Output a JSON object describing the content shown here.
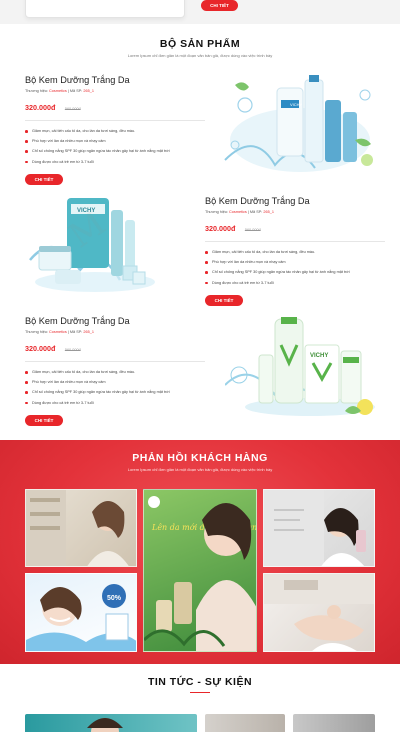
{
  "top": {
    "button_label": "CHI TIẾT"
  },
  "products_section": {
    "title": "BỘ SẢN PHẨM",
    "subtitle": "Lorem Ipsum chỉ đơn giản là một đoạn văn bản giả, được dùng vào việc trình bày"
  },
  "products": [
    {
      "name": "Bộ Kem Dưỡng Trắng Da",
      "brand_label": "Thương hiệu:",
      "brand": "Cosmetics",
      "sku_label": "Mã SP:",
      "sku": "265_1",
      "price": "320.000đ",
      "old_price": "560.000đ",
      "features": [
        "Giảm mụn, cải tiến cấu tố da, cho làn da tươi sáng, đều màu.",
        "Phù hợp với làn da nhiều mụn và nhạy cảm",
        "Chỉ số chống nắng SPF 30 giúp ngăn ngừa tác nhân gây hại từ ánh nắng mặt trời",
        "Dùng được cho cả trẻ em từ 3-7 tuổi"
      ],
      "button_label": "CHI TIẾT"
    },
    {
      "name": "Bộ Kem Dưỡng Trắng Da",
      "brand_label": "Thương hiệu:",
      "brand": "Cosmetics",
      "sku_label": "Mã SP:",
      "sku": "265_1",
      "price": "320.000đ",
      "old_price": "560.000đ",
      "features": [
        "Giảm mụn, cải tiến cấu tố da, cho làn da tươi sáng, đều màu.",
        "Phù hợp với làn da nhiều mụn và nhạy cảm",
        "Chỉ số chống nắng SPF 30 giúp ngăn ngừa tác nhân gây hại từ ánh nắng mặt trời",
        "Dùng được cho cả trẻ em từ 3-7 tuổi"
      ],
      "button_label": "CHI TIẾT"
    },
    {
      "name": "Bộ Kem Dưỡng Trắng Da",
      "brand_label": "Thương hiệu:",
      "brand": "Cosmetics",
      "sku_label": "Mã SP:",
      "sku": "265_1",
      "price": "320.000đ",
      "old_price": "560.000đ",
      "features": [
        "Giảm mụn, cải tiến cấu tố da, cho làn da tươi sáng, đều màu.",
        "Phù hợp với làn da nhiều mụn và nhạy cảm",
        "Chỉ số chống nắng SPF 30 giúp ngăn ngừa tác nhân gây hại từ ánh nắng mặt trời",
        "Dùng được cho cả trẻ em từ 3-7 tuổi"
      ],
      "button_label": "CHI TIẾT"
    }
  ],
  "product_images": [
    "VICHY",
    "VICHY",
    "VICHY"
  ],
  "feedback_section": {
    "title": "PHẢN HỒI KHÁCH HÀNG",
    "subtitle": "Lorem Ipsum chỉ đơn giản là một đoạn văn bản giả, được dùng vào việc trình bày",
    "promo_text": "Lên da mới được mịn màng",
    "sale_badge": "50%"
  },
  "news_section": {
    "title": "TIN TỨC - SỰ KIỆN"
  },
  "colors": {
    "accent": "#e8262a",
    "feedback_bg": "#e3323a"
  }
}
